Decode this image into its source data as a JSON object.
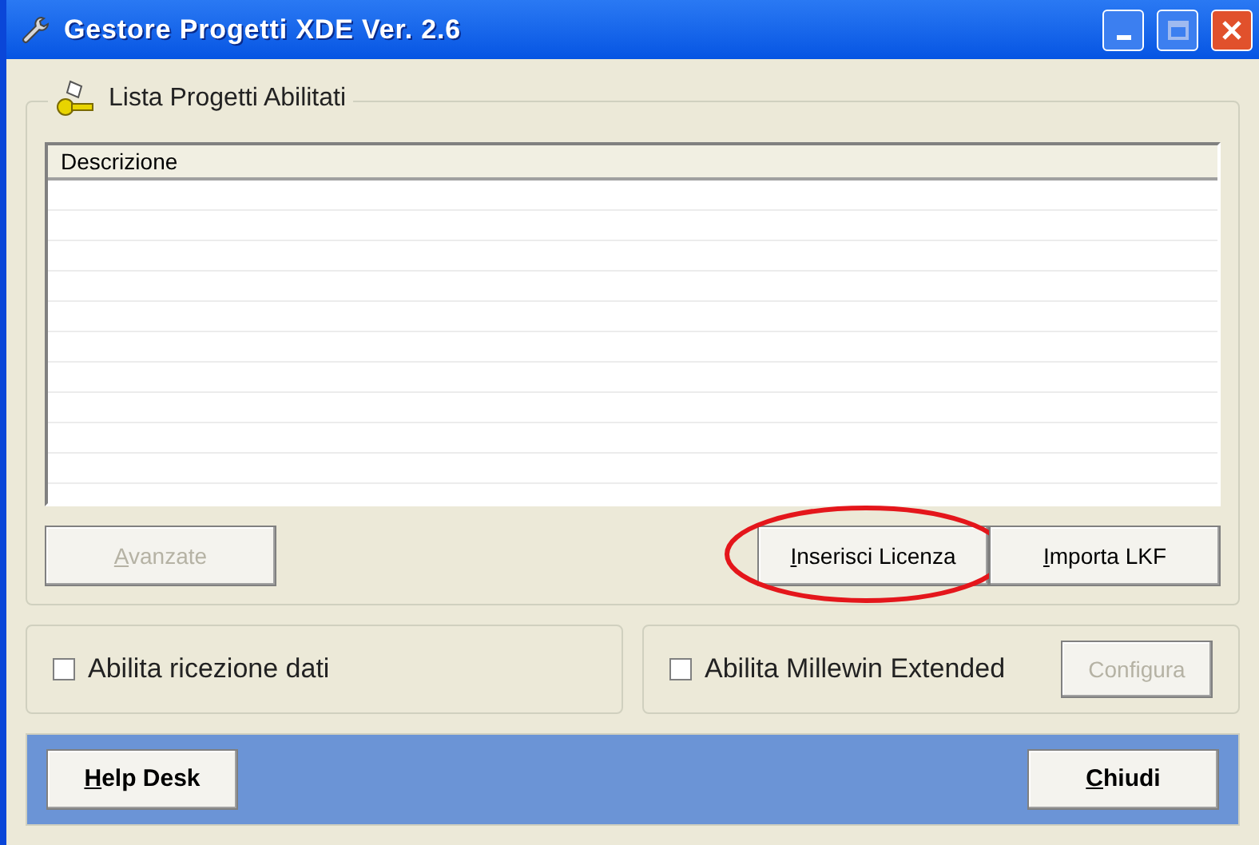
{
  "window": {
    "title": "Gestore Progetti XDE Ver. 2.6"
  },
  "group": {
    "title": "Lista Progetti Abilitati"
  },
  "table": {
    "columns": [
      "Descrizione"
    ]
  },
  "list_buttons": [
    {
      "label": "Avanzate",
      "disabled": true,
      "mnemonic": true,
      "highlighted": false
    },
    {
      "label": "Inserisci Licenza",
      "disabled": false,
      "mnemonic": true,
      "highlighted": true
    },
    {
      "label": "Importa LKF",
      "disabled": false,
      "mnemonic": true,
      "highlighted": false
    }
  ],
  "options": [
    {
      "label": "Abilita ricezione dati",
      "checked": false
    },
    {
      "label": "Abilita Millewin Extended",
      "checked": false,
      "button": {
        "label": "Configura",
        "disabled": true,
        "mnemonic": false
      }
    }
  ],
  "footer_buttons": [
    {
      "label": "Help Desk",
      "mnemonic": true
    },
    {
      "label": "Chiudi",
      "mnemonic": true
    }
  ]
}
